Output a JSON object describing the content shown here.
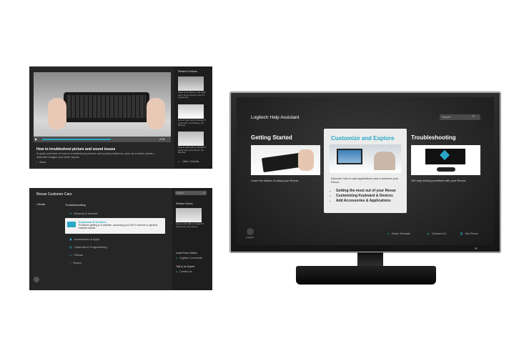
{
  "screen1": {
    "video_title": "How to troubleshoot picture and sound issues",
    "video_desc": "A quick overview of how to troubleshoot picture and sound problems, such as a black screen, distorted images and other issues.",
    "time": "2:31",
    "back_label": "Back",
    "related_heading": "Related Videos",
    "related": [
      "What is the Revue, and what can it do to improve your TV experience",
      "How to start with a GoogleTV setup from your Revue, the Remote",
      "How to start with a GoogleTV setup from your Revue, the Remote"
    ],
    "video_tutorials": "Video Tutorials"
  },
  "screen2": {
    "title": "Revue Customer Care",
    "search_placeholder": "Search",
    "home_label": "Home",
    "section": "Troubleshooting",
    "items": [
      {
        "label": "Network & Internet"
      },
      {
        "label": "Keyboard & Devices",
        "desc": "Problems getting to a website, accessing your Wi-Fi network or general network issues."
      },
      {
        "label": "Accessories & Apps"
      },
      {
        "label": "Channels & Programming"
      },
      {
        "label": "Picture"
      },
      {
        "label": "Sound"
      }
    ],
    "related_heading": "Related Videos",
    "related_caption": "How to start with a GoogleTV setup from your Revue",
    "learn_heading": "Learn From Others",
    "community": "Logitech Community",
    "talk_heading": "Talk to an Expert",
    "contact": "Contact Us"
  },
  "tv": {
    "title": "Logitech Help Assistant",
    "search_placeholder": "Search",
    "cards": [
      {
        "title": "Getting Started",
        "desc": "Learn the basics of using your Revue."
      },
      {
        "title": "Customize and Explore",
        "desc": "Discover how to add applications and customize your Revue.",
        "bullets": [
          "Getting the most out of your Revue",
          "Customizing Keyboard & Devices",
          "Add Accessories & Applications"
        ]
      },
      {
        "title": "Troubleshooting",
        "desc": "Get help solving problems with your Revue."
      }
    ],
    "footer": [
      "Video Tutorials",
      "Contact Us",
      "My Revue"
    ],
    "logo_text": "Logitech"
  },
  "colors": {
    "accent": "#2aa7c7",
    "screen_bg": "#262626"
  }
}
